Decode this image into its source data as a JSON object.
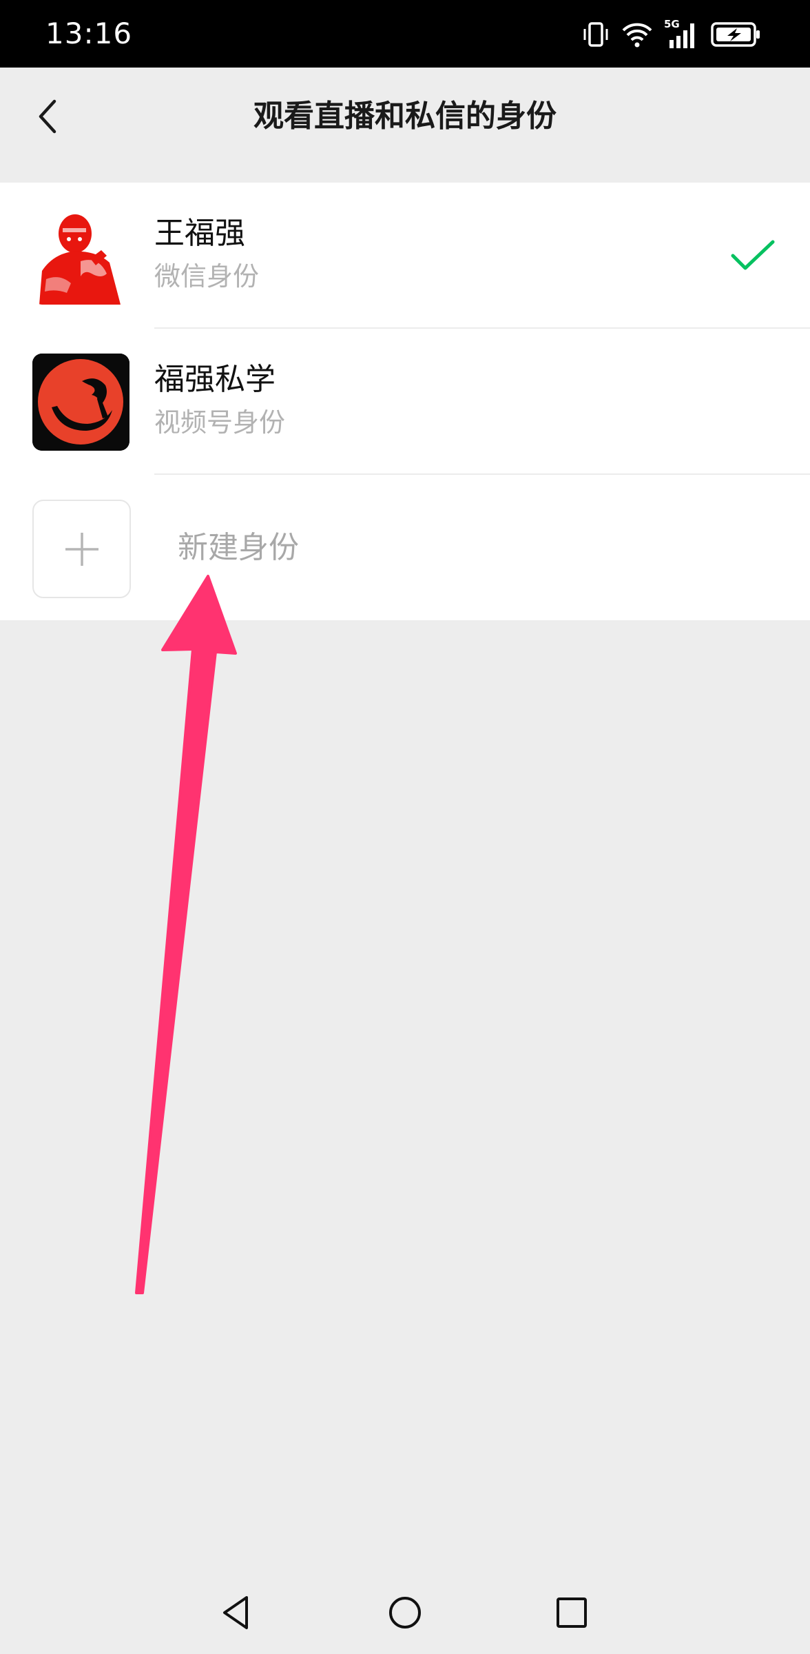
{
  "status_bar": {
    "time": "13:16",
    "icons": [
      "vibrate-icon",
      "wifi-icon",
      "5g-signal-icon",
      "battery-charging-icon"
    ],
    "network_label": "5G"
  },
  "header": {
    "title": "观看直播和私信的身份",
    "back_icon": "chevron-left-icon"
  },
  "identities": [
    {
      "name": "王福强",
      "type": "微信身份",
      "selected": true,
      "avatar": "red-portrait-avatar"
    },
    {
      "name": "福强私学",
      "type": "视频号身份",
      "selected": false,
      "avatar": "red-circle-logo-avatar"
    }
  ],
  "create_identity": {
    "label": "新建身份",
    "icon": "plus-icon"
  },
  "annotation": {
    "type": "arrow",
    "color": "#ff3370"
  },
  "colors": {
    "accent_check": "#07c160",
    "background": "#ededed",
    "secondary_text": "#b2b2b2"
  },
  "system_nav": [
    "back-triangle-icon",
    "home-circle-icon",
    "recents-square-icon"
  ]
}
